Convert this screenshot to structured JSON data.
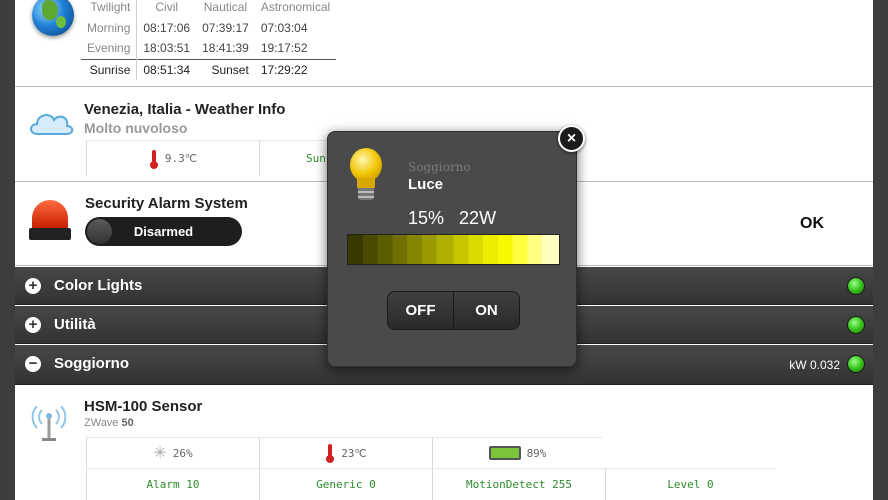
{
  "twilight": {
    "headers": [
      "Twilight",
      "Civil",
      "Nautical",
      "Astronomical"
    ],
    "morning": {
      "label": "Morning",
      "civil": "08:17:06",
      "nautical": "07:39:17",
      "astronomical": "07:03:04"
    },
    "evening": {
      "label": "Evening",
      "civil": "18:03:51",
      "nautical": "18:41:39",
      "astronomical": "19:17:52"
    },
    "sun": {
      "sunrise_label": "Sunrise",
      "sunrise": "08:51:34",
      "sunset_label": "Sunset",
      "sunset": "17:29:22"
    }
  },
  "weather": {
    "title": "Venezia, Italia - Weather Info",
    "condition": "Molto nuvoloso",
    "temperature": "9.3℃",
    "partial_label": "Sun"
  },
  "alarm": {
    "title": "Security Alarm System",
    "state": "Disarmed",
    "status": "OK"
  },
  "groups": [
    {
      "label": "Color Lights",
      "toggle": "+"
    },
    {
      "label": "Utilità",
      "toggle": "+"
    },
    {
      "label": "Soggiorno",
      "toggle": "−",
      "power": "kW 0.032"
    }
  ],
  "sensor": {
    "title": "HSM-100 Sensor",
    "type": "ZWave",
    "id": "50",
    "luminance": "26%",
    "temperature": "23℃",
    "battery": "89%",
    "stats": [
      "Alarm 10",
      "Generic 0",
      "MotionDetect 255",
      "Level 0"
    ]
  },
  "popup": {
    "room": "Soggiorno",
    "device": "Luce",
    "level": "15%",
    "power": "22W",
    "off_label": "OFF",
    "on_label": "ON",
    "close_glyph": "×"
  }
}
